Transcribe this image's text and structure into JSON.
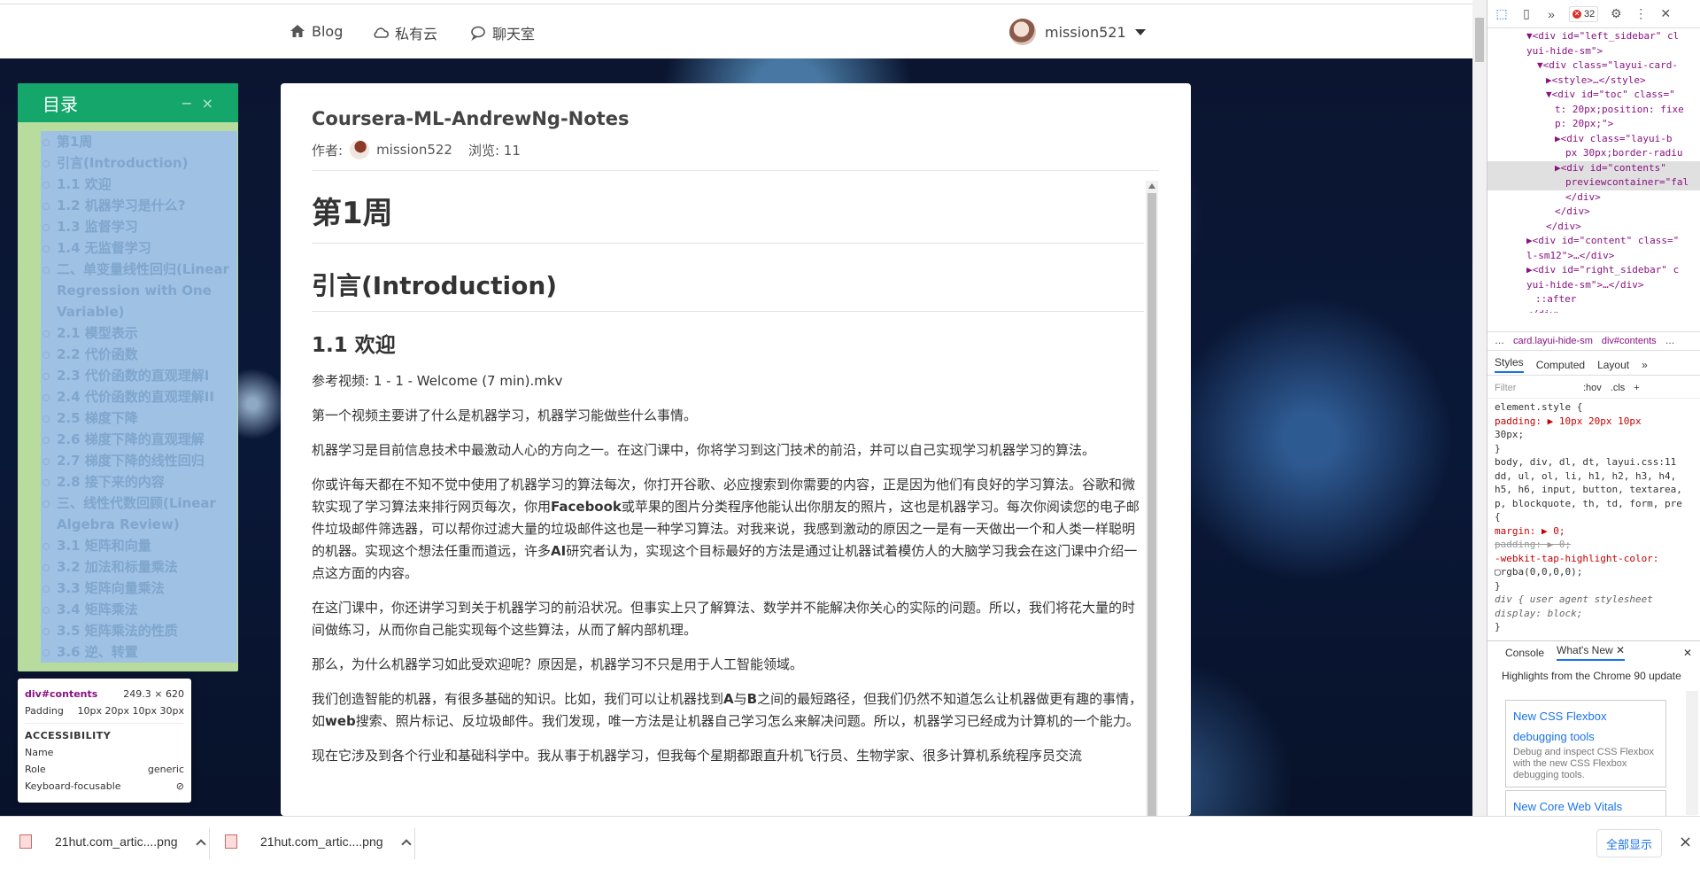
{
  "nav": {
    "links": [
      {
        "label": "Blog",
        "icon": "home-icon"
      },
      {
        "label": "私有云",
        "icon": "cloud-icon"
      },
      {
        "label": "聊天室",
        "icon": "chat-icon"
      }
    ],
    "user": "mission521"
  },
  "toc": {
    "title": "目录",
    "minimize": "−",
    "close": "×",
    "items": [
      "第1周",
      "引言(Introduction)",
      "1.1 欢迎",
      "1.2 机器学习是什么?",
      "1.3 监督学习",
      "1.4 无监督学习",
      "二、单变量线性回归(Linear Regression with One Variable)",
      "2.1 模型表示",
      "2.2 代价函数",
      "2.3 代价函数的直观理解I",
      "2.4 代价函数的直观理解II",
      "2.5 梯度下降",
      "2.6 梯度下降的直观理解",
      "2.7 梯度下降的线性回归",
      "2.8 接下来的内容",
      "三、线性代数回顾(Linear Algebra Review)",
      "3.1 矩阵和向量",
      "3.2 加法和标量乘法",
      "3.3 矩阵向量乘法",
      "3.4 矩阵乘法",
      "3.5 矩阵乘法的性质",
      "3.6 逆、转置"
    ]
  },
  "tooltip": {
    "element": "div#contents",
    "size": "249.3 × 620",
    "padding_label": "Padding",
    "padding_value": "10px 20px 10px 30px",
    "section": "ACCESSIBILITY",
    "rows": [
      {
        "k": "Name",
        "v": ""
      },
      {
        "k": "Role",
        "v": "generic"
      },
      {
        "k": "Keyboard-focusable",
        "v": "⊘"
      }
    ]
  },
  "article": {
    "title": "Coursera-ML-AndrewNg-Notes",
    "author_label": "作者:",
    "author": "mission522",
    "views": "浏览: 11",
    "h1": "第1周",
    "h2": "引言(Introduction)",
    "h3": "1.1 欢迎",
    "p1": "参考视频: 1 - 1 - Welcome (7 min).mkv",
    "p2": "第一个视频主要讲了什么是机器学习，机器学习能做些什么事情。",
    "p3": "机器学习是目前信息技术中最激动人心的方向之一。在这门课中，你将学习到这门技术的前沿，并可以自己实现学习机器学习的算法。",
    "p4a": "你或许每天都在不知不觉中使用了机器学习的算法每次，你打开谷歌、必应搜索到你需要的内容，正是因为他们有良好的学习算法。谷歌和微软实现了学习算法来排行网页每次，你用",
    "p4b": "Facebook",
    "p4c": "或苹果的图片分类程序他能认出你朋友的照片，这也是机器学习。每次你阅读您的电子邮件垃圾邮件筛选器，可以帮你过滤大量的垃圾邮件这也是一种学习算法。对我来说，我感到激动的原因之一是有一天做出一个和人类一样聪明的机器。实现这个想法任重而道远，许多",
    "p4d": "AI",
    "p4e": "研究者认为，实现这个目标最好的方法是通过让机器试着模仿人的大脑学习我会在这门课中介绍一点这方面的内容。",
    "p5": "在这门课中，你还讲学习到关于机器学习的前沿状况。但事实上只了解算法、数学并不能解决你关心的实际的问题。所以，我们将花大量的时间做练习，从而你自己能实现每个这些算法，从而了解内部机理。",
    "p6": "那么，为什么机器学习如此受欢迎呢？原因是，机器学习不只是用于人工智能领域。",
    "p7a": "我们创造智能的机器，有很多基础的知识。比如，我们可以让机器找到",
    "p7b": "A",
    "p7c": "与",
    "p7d": "B",
    "p7e": "之间的最短路径，但我们仍然不知道怎么让机器做更有趣的事情，如",
    "p7f": "web",
    "p7g": "搜索、照片标记、反垃圾邮件。我们发现，唯一方法是让机器自己学习怎么来解决问题。所以，机器学习已经成为计算机的一个能力。",
    "p8": "现在它涉及到各个行业和基础科学中。我从事于机器学习，但我每个星期都跟直升机飞行员、生物学家、很多计算机系统程序员交流"
  },
  "devtools": {
    "error_count": "32",
    "dom_lines": [
      "▼<div id=\"left_sidebar\" cl",
      "yui-hide-sm\">",
      "▼<div class=\"layui-card-",
      "▶<style>…</style>",
      "▼<div id=\"toc\" class=\"",
      "t: 20px;position: fixe",
      "p: 20px;\">",
      "▶<div class=\"layui-b",
      "px 30px;border-radiu",
      "▶<div id=\"contents\"",
      "previewcontainer=\"fal",
      "</div>",
      "</div>",
      "</div>",
      "▶<div id=\"content\" class=\"",
      "l-sm12\">…</div>",
      "▶<div id=\"right_sidebar\" c",
      "yui-hide-sm\">…</div>",
      "::after",
      "</div>"
    ],
    "crumbs": [
      "…",
      "card.layui-hide-sm",
      "div#contents",
      "…"
    ],
    "style_tabs": [
      "Styles",
      "Computed",
      "Layout",
      "»"
    ],
    "filter_placeholder": "Filter",
    "filter_tools": [
      ":hov",
      ".cls",
      "+"
    ],
    "css_lines": [
      "element.style {",
      "  padding: ▶ 10px 20px 10px",
      "      30px;",
      "}",
      "body, div, dl, dt,   layui.css:11",
      "dd, ul, ol, li, h1, h2, h3, h4,",
      "h5, h6, input, button, textarea,",
      "p, blockquote, th, td, form, pre",
      "{",
      "  margin: ▶ 0;",
      "  padding: ▶ 0;",
      "  -webkit-tap-highlight-color:",
      "      ▢rgba(0,0,0,0);",
      "}",
      "div {        user agent stylesheet",
      "  display: block;",
      "}"
    ],
    "drawer_tabs": [
      "Console",
      "What's New"
    ],
    "whats_new_heading": "Highlights from the Chrome 90 update",
    "cards": [
      {
        "title": "New CSS Flexbox debugging tools",
        "desc": "Debug and inspect CSS Flexbox with the new CSS Flexbox debugging tools."
      },
      {
        "title": "New Core Web Vitals",
        "desc": ""
      }
    ]
  },
  "downloads": {
    "items": [
      "21hut.com_artic....png",
      "21hut.com_artic....png"
    ],
    "show_all": "全部显示",
    "close": "×"
  }
}
